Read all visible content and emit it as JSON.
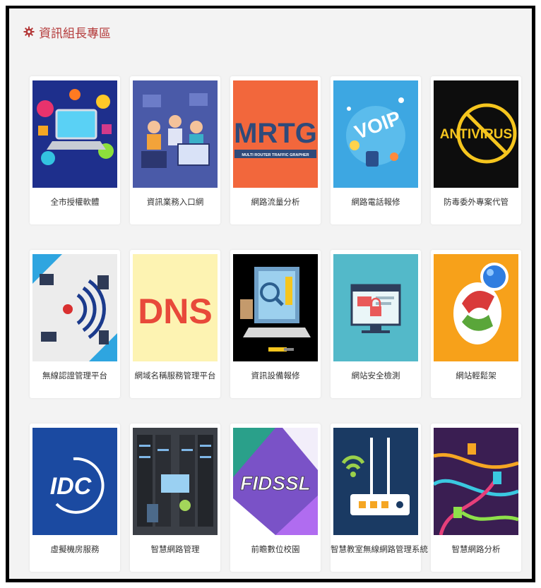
{
  "header": {
    "title": "資訊組長專區",
    "icon": "gear-icon",
    "title_color": "#b43a3a"
  },
  "cards": [
    {
      "label": "全市授權軟體",
      "thumb_text": "",
      "bg": "#1e2f8c"
    },
    {
      "label": "資訊業務入口網",
      "thumb_text": "",
      "bg": "#4a5aa8"
    },
    {
      "label": "網路流量分析",
      "thumb_text": "MRTG",
      "thumb_subtext": "MULTI ROUTER TRAFFIC GRAPHER",
      "bg": "#f2673c"
    },
    {
      "label": "網路電話報修",
      "thumb_text": "VOIP",
      "bg": "#3da7e2"
    },
    {
      "label": "防毒委外專案代管",
      "thumb_text": "ANTIVIRUS",
      "bg": "#0d0d0d"
    },
    {
      "label": "無線認證管理平台",
      "thumb_text": "",
      "bg": "#ececec"
    },
    {
      "label": "網域名稱服務管理平台",
      "thumb_text": "DNS",
      "bg": "#fdf3b2"
    },
    {
      "label": "資訊設備報修",
      "thumb_text": "",
      "bg": "#000000"
    },
    {
      "label": "網站安全檢測",
      "thumb_text": "",
      "bg": "#53b9c9"
    },
    {
      "label": "網站輕鬆架",
      "thumb_text": "",
      "bg": "#f7a11a"
    },
    {
      "label": "虛擬機房服務",
      "thumb_text": "IDC",
      "bg": "#1b4aa1"
    },
    {
      "label": "智慧網路管理",
      "thumb_text": "",
      "bg": "#3b3f46"
    },
    {
      "label": "前瞻數位校園",
      "thumb_text": "FIDSSL",
      "bg": "#7a52c7"
    },
    {
      "label": "智慧教室無線網路管理系統",
      "thumb_text": "",
      "bg": "#1a3a63"
    },
    {
      "label": "智慧網路分析",
      "thumb_text": "",
      "bg": "#3a1e52"
    }
  ]
}
